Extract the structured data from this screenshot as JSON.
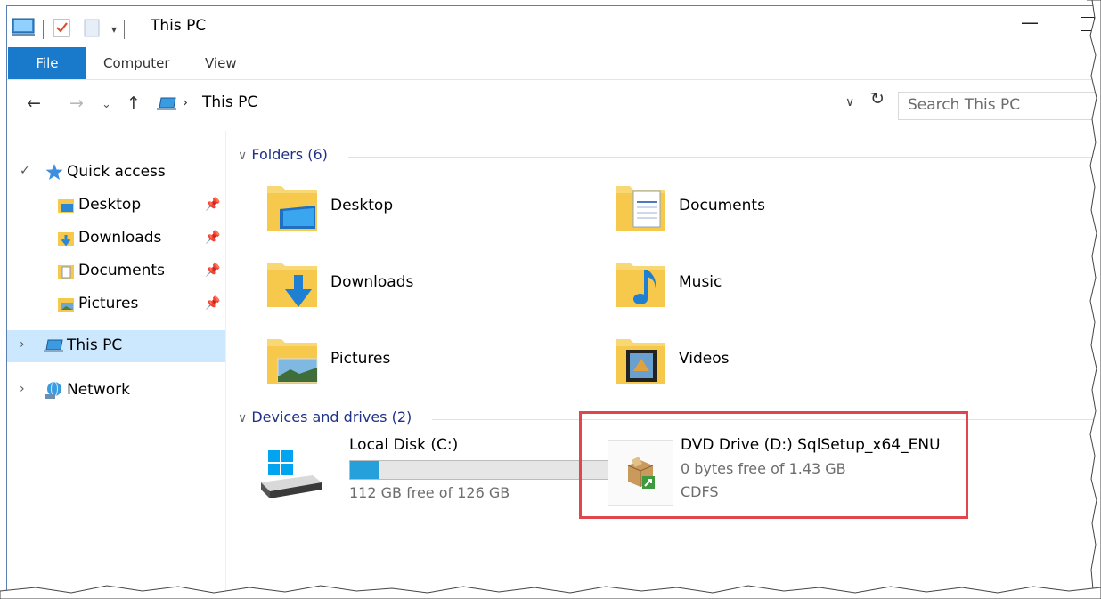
{
  "window": {
    "title": "This PC"
  },
  "ribbon": {
    "tabs": [
      "File",
      "Computer",
      "View"
    ]
  },
  "address": {
    "path": "This PC",
    "search_placeholder": "Search This PC"
  },
  "nav_pane": {
    "quick_access": "Quick access",
    "quick_items": [
      "Desktop",
      "Downloads",
      "Documents",
      "Pictures"
    ],
    "this_pc": "This PC",
    "network": "Network"
  },
  "content": {
    "folders_header": "Folders (6)",
    "folders": [
      "Desktop",
      "Documents",
      "Downloads",
      "Music",
      "Pictures",
      "Videos"
    ],
    "devices_header": "Devices and drives (2)",
    "drives": [
      {
        "name": "Local Disk (C:)",
        "free": "112 GB free of 126 GB",
        "used_fraction": 0.11,
        "fs": ""
      },
      {
        "name": "DVD Drive (D:) SqlSetup_x64_ENU",
        "free": "0 bytes free of 1.43 GB",
        "fs": "CDFS"
      }
    ]
  },
  "colors": {
    "file_tab": "#1979ca",
    "selected": "#cce8ff",
    "group_header": "#1e3287",
    "highlight": "#e0474c",
    "bar_fill": "#26a0da"
  }
}
